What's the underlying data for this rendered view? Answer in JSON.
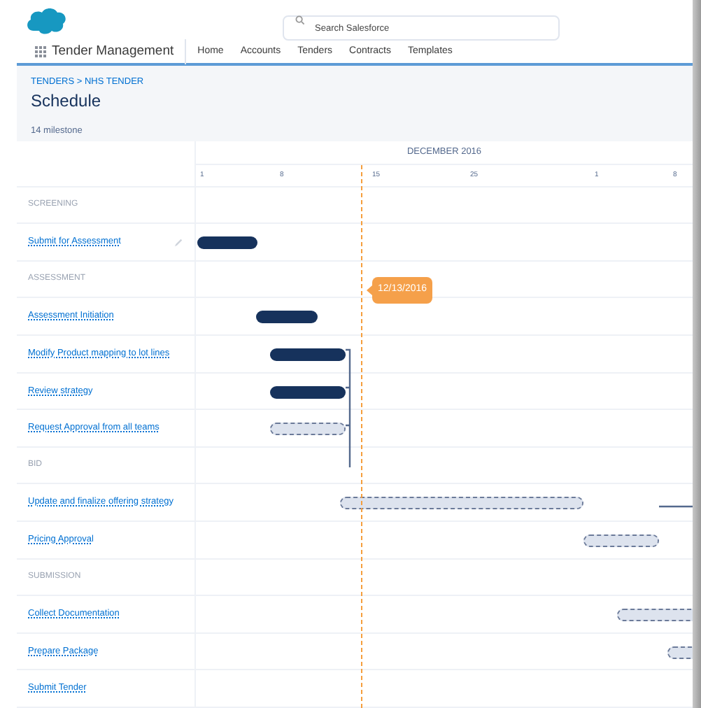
{
  "header": {
    "search": {
      "placeholder": "Search Salesforce"
    }
  },
  "nav": {
    "app_name": "Tender Management",
    "items": [
      {
        "label": "Home",
        "selected": false
      },
      {
        "label": "Accounts",
        "selected": false
      },
      {
        "label": "Tenders",
        "selected": false
      },
      {
        "label": "Contracts",
        "selected": false
      },
      {
        "label": "Templates",
        "selected": false
      }
    ]
  },
  "page": {
    "breadcrumb": "TENDERS > NHS TENDER",
    "title": "Schedule",
    "subtitle": "14 milestone"
  },
  "timeline": {
    "month": "DECEMBER 2016",
    "ticks": [
      "1",
      "8",
      "15",
      "25",
      "1",
      "8"
    ],
    "today": {
      "label": "12/13/2016"
    }
  },
  "rows": [
    {
      "kind": "section",
      "label": "SCREENING"
    },
    {
      "kind": "task",
      "label": "Submit for Assessment",
      "editable": true,
      "completed": true
    },
    {
      "kind": "section",
      "label": "ASSESSMENT"
    },
    {
      "kind": "task",
      "label": "Assessment Initiation",
      "editable": false,
      "completed": true
    },
    {
      "kind": "task",
      "label": "Modify Product mapping to lot lines",
      "editable": false,
      "completed": true
    },
    {
      "kind": "task",
      "label": "Review strategy",
      "editable": false,
      "completed": true
    },
    {
      "kind": "task",
      "label": "Request Approval from all teams",
      "editable": false,
      "completed": false
    },
    {
      "kind": "section",
      "label": "BID"
    },
    {
      "kind": "task",
      "label": "Update and finalize offering strategy",
      "editable": false,
      "completed": false
    },
    {
      "kind": "task",
      "label": "Pricing Approval",
      "editable": false,
      "completed": false
    },
    {
      "kind": "section",
      "label": "SUBMISSION"
    },
    {
      "kind": "task",
      "label": "Collect Documentation",
      "editable": false,
      "completed": false
    },
    {
      "kind": "task",
      "label": "Prepare Package",
      "editable": false,
      "completed": false
    },
    {
      "kind": "task",
      "label": "Submit Tender",
      "editable": false
    }
  ]
}
